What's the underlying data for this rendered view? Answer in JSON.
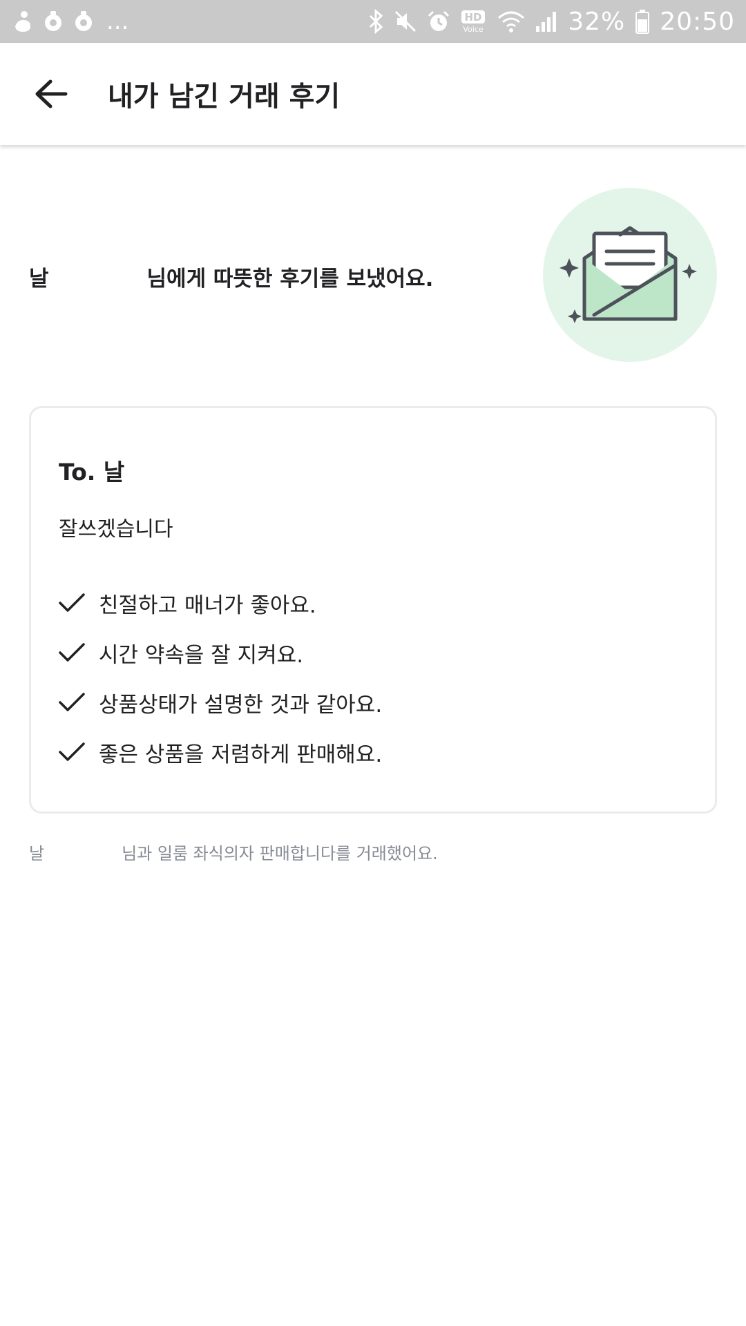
{
  "status_bar": {
    "left_icons": [
      "hand-notification-icon",
      "app-notification-icon",
      "app-notification-icon"
    ],
    "more_indicator": "...",
    "right_icons": [
      "bluetooth-icon",
      "mute-icon",
      "alarm-icon",
      "hd-voice-icon",
      "wifi-icon",
      "signal-icon",
      "battery-icon"
    ],
    "hd_label": "HD",
    "voice_label": "Voice",
    "battery_percent": "32%",
    "time": "20:50"
  },
  "app_bar": {
    "back_icon": "arrow-left-icon",
    "title": "내가 남긴 거래 후기"
  },
  "summary": {
    "prefix": "날",
    "suffix": "님에게 따뜻한 후기를 보냈어요."
  },
  "illustration": {
    "icon": "open-envelope-letter-icon",
    "circle_color": "#e3f5e9",
    "envelope_color": "#bde5c8",
    "stroke_color": "#4d5159"
  },
  "review_card": {
    "to_label": "To. 날",
    "message": "잘쓰겠습니다",
    "check_icon": "checkmark-icon",
    "items": [
      "친절하고 매너가 좋아요.",
      "시간 약속을 잘 지켜요.",
      "상품상태가 설명한 것과 같아요.",
      "좋은 상품을 저렴하게 판매해요."
    ]
  },
  "footer": {
    "prefix": "날",
    "suffix": "님과 일룸 좌식의자 판매합니다를 거래했어요."
  },
  "colors": {
    "text_primary": "#212124",
    "text_secondary": "#868b94",
    "card_border": "#eaebee",
    "status_bar": "#c9c9c9"
  }
}
